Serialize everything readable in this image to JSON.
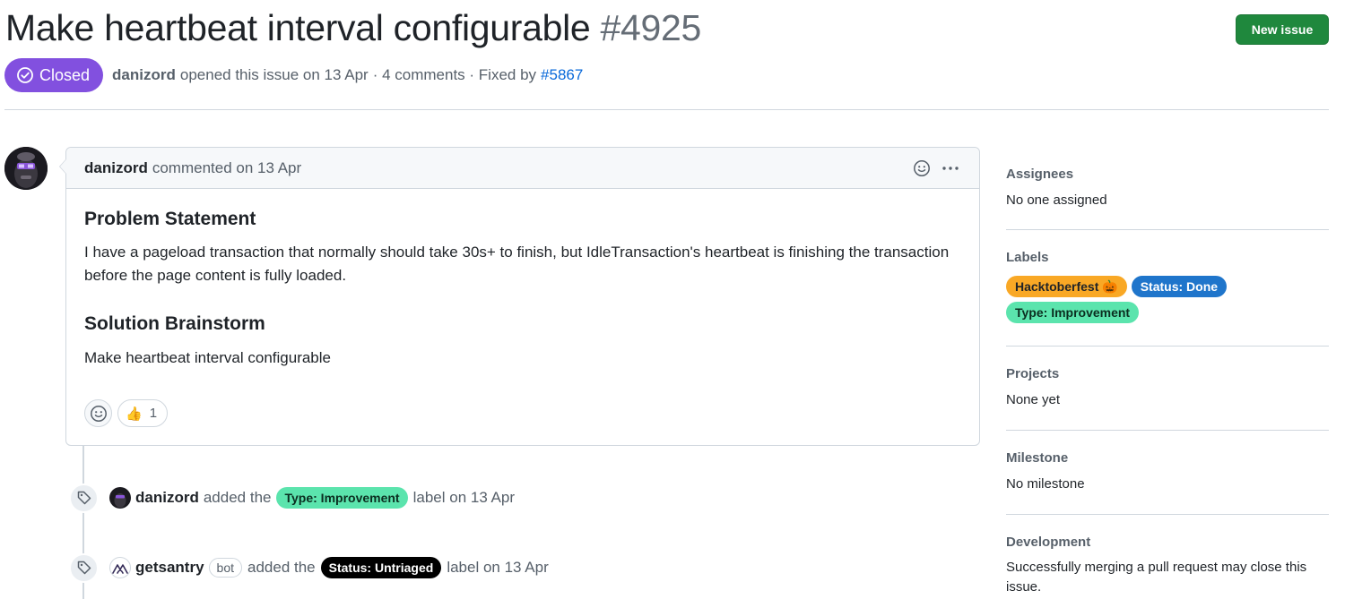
{
  "issue": {
    "title": "Make heartbeat interval configurable",
    "number": "#4925",
    "state": "Closed",
    "author": "danizord",
    "opened_text": "opened this issue on 13 Apr",
    "comments_text": "· 4 comments · Fixed by",
    "fixed_by": "#5867",
    "new_issue_label": "New issue"
  },
  "comment": {
    "author": "danizord",
    "meta": "commented on 13 Apr",
    "heading1": "Problem Statement",
    "paragraph1": "I have a pageload transaction that normally should take 30s+ to finish, but IdleTransaction's heartbeat is finishing the transaction before the page content is fully loaded.",
    "heading2": "Solution Brainstorm",
    "paragraph2": "Make heartbeat interval configurable",
    "reaction_emoji": "👍",
    "reaction_count": "1"
  },
  "timeline": [
    {
      "actor": "danizord",
      "action": "added the",
      "label": "Type: Improvement",
      "label_bg": "#5be4ad",
      "label_fg": "#0b2e20",
      "suffix": "label on 13 Apr"
    },
    {
      "actor": "getsantry",
      "badge": "bot",
      "action": "added the",
      "label": "Status: Untriaged",
      "label_bg": "#000000",
      "label_fg": "#ffffff",
      "suffix": "label on 13 Apr"
    }
  ],
  "sidebar": {
    "assignees": {
      "title": "Assignees",
      "value": "No one assigned"
    },
    "labels": {
      "title": "Labels",
      "items": [
        {
          "name": "Hacktoberfest 🎃",
          "bg": "#f9a825",
          "fg": "#1f2328"
        },
        {
          "name": "Status: Done",
          "bg": "#1f75cb",
          "fg": "#ffffff"
        },
        {
          "name": "Type: Improvement",
          "bg": "#5be4ad",
          "fg": "#0b2e20"
        }
      ]
    },
    "projects": {
      "title": "Projects",
      "value": "None yet"
    },
    "milestone": {
      "title": "Milestone",
      "value": "No milestone"
    },
    "development": {
      "title": "Development",
      "value": "Successfully merging a pull request may close this issue."
    }
  },
  "colors": {
    "closed": "#8250df",
    "primary_button": "#1f883d",
    "link": "#0969da"
  }
}
